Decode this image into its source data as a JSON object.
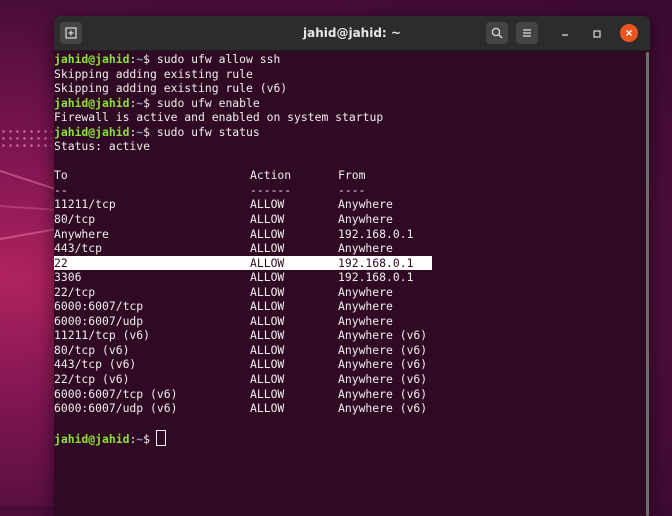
{
  "window": {
    "title": "jahid@jahid: ~"
  },
  "prompt": {
    "user_host": "jahid@jahid",
    "sep": ":",
    "path": "~",
    "symbol": "$"
  },
  "commands": {
    "cmd1": "sudo ufw allow ssh",
    "out1a": "Skipping adding existing rule",
    "out1b": "Skipping adding existing rule (v6)",
    "cmd2": "sudo ufw enable",
    "out2": "Firewall is active and enabled on system startup",
    "cmd3": "sudo ufw status",
    "status": "Status: active"
  },
  "table": {
    "headers": {
      "to": "To",
      "action": "Action",
      "from": "From"
    },
    "underlines": {
      "to": "--",
      "action": "------",
      "from": "----"
    },
    "rows": [
      {
        "to": "11211/tcp",
        "action": "ALLOW",
        "from": "Anywhere"
      },
      {
        "to": "80/tcp",
        "action": "ALLOW",
        "from": "Anywhere"
      },
      {
        "to": "Anywhere",
        "action": "ALLOW",
        "from": "192.168.0.1"
      },
      {
        "to": "443/tcp",
        "action": "ALLOW",
        "from": "Anywhere"
      },
      {
        "to": "22",
        "action": "ALLOW",
        "from": "192.168.0.1"
      },
      {
        "to": "3306",
        "action": "ALLOW",
        "from": "192.168.0.1"
      },
      {
        "to": "22/tcp",
        "action": "ALLOW",
        "from": "Anywhere"
      },
      {
        "to": "6000:6007/tcp",
        "action": "ALLOW",
        "from": "Anywhere"
      },
      {
        "to": "6000:6007/udp",
        "action": "ALLOW",
        "from": "Anywhere"
      },
      {
        "to": "11211/tcp (v6)",
        "action": "ALLOW",
        "from": "Anywhere (v6)"
      },
      {
        "to": "80/tcp (v6)",
        "action": "ALLOW",
        "from": "Anywhere (v6)"
      },
      {
        "to": "443/tcp (v6)",
        "action": "ALLOW",
        "from": "Anywhere (v6)"
      },
      {
        "to": "22/tcp (v6)",
        "action": "ALLOW",
        "from": "Anywhere (v6)"
      },
      {
        "to": "6000:6007/tcp (v6)",
        "action": "ALLOW",
        "from": "Anywhere (v6)"
      },
      {
        "to": "6000:6007/udp (v6)",
        "action": "ALLOW",
        "from": "Anywhere (v6)"
      }
    ]
  },
  "icons": {
    "new_tab": "new-tab-icon",
    "search": "search-icon",
    "menu": "hamburger-menu-icon",
    "minimize": "minimize-icon",
    "maximize": "maximize-icon",
    "close": "close-icon"
  },
  "colors": {
    "terminal_bg": "#300a24",
    "prompt_green": "#8ae234",
    "path_blue": "#729fcf",
    "close_orange": "#e95420",
    "highlight": "#ffffff"
  }
}
